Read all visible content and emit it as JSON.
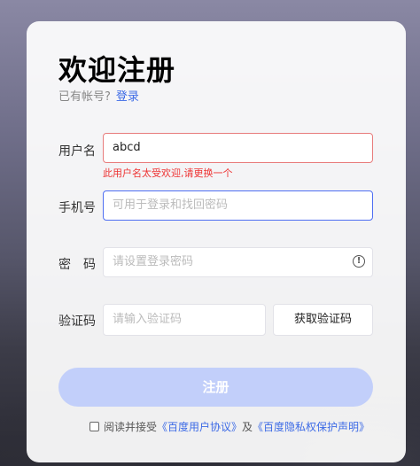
{
  "page": {
    "title": "欢迎注册",
    "has_account_text": "已有帐号?",
    "login_link": "登录"
  },
  "form": {
    "username": {
      "label": "用户名",
      "value": "abcd",
      "error": "此用户名太受欢迎,请更换一个"
    },
    "phone": {
      "label": "手机号",
      "placeholder": "可用于登录和找回密码"
    },
    "password": {
      "label": "密　码",
      "placeholder": "请设置登录密码",
      "info_icon": "info-circle-icon"
    },
    "verify": {
      "label": "验证码",
      "placeholder": "请输入验证码",
      "button": "获取验证码"
    },
    "submit": "注册"
  },
  "agreement": {
    "prefix": "阅读并接受",
    "link1": "《百度用户协议》",
    "and": "及",
    "link2": "《百度隐私权保护声明》"
  },
  "colors": {
    "accent": "#3c6ae6",
    "error": "#e33333",
    "submit_disabled": "#c2cffa"
  }
}
